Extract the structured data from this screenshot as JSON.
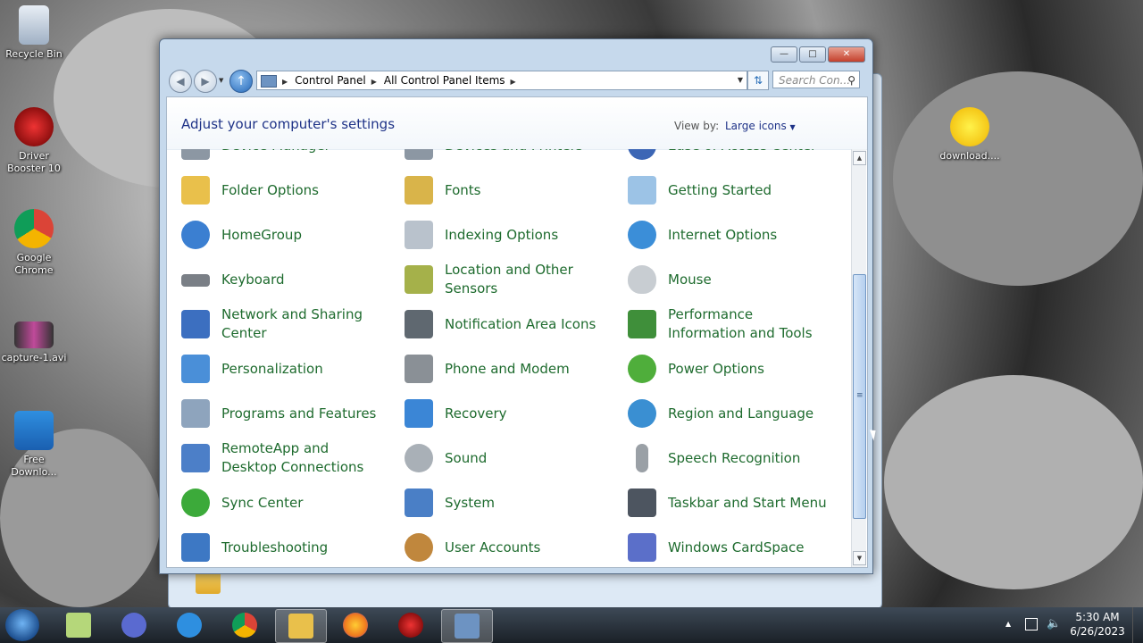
{
  "desktop": {
    "icons": [
      {
        "label": "Recycle Bin",
        "icon": "recycle-bin-icon"
      },
      {
        "label": "Driver Booster 10",
        "icon": "driver-booster-icon"
      },
      {
        "label": "Google Chrome",
        "icon": "chrome-icon"
      },
      {
        "label": "capture-1.avi",
        "icon": "video-file-icon"
      },
      {
        "label": "Free Downlo...",
        "icon": "free-download-icon"
      },
      {
        "label": "download....",
        "icon": "smiley-image-icon"
      }
    ]
  },
  "window": {
    "breadcrumb": [
      "Control Panel",
      "All Control Panel Items"
    ],
    "search_placeholder": "Search Con...",
    "header_title": "Adjust your computer's settings",
    "view_by_label": "View by:",
    "view_by_value": "Large icons",
    "partial_top_items": [
      "Device Manager",
      "Devices and Printers",
      "Ease of Access Center"
    ],
    "items": [
      {
        "label": "Folder Options",
        "color": "#e9c04b"
      },
      {
        "label": "Fonts",
        "color": "#d9b44a"
      },
      {
        "label": "Getting Started",
        "color": "#9cc3e6"
      },
      {
        "label": "HomeGroup",
        "color": "#3b7fd1"
      },
      {
        "label": "Indexing Options",
        "color": "#b9c2cc"
      },
      {
        "label": "Internet Options",
        "color": "#3b8ed8"
      },
      {
        "label": "Keyboard",
        "color": "#7a7f86"
      },
      {
        "label": "Location and Other Sensors",
        "color": "#a5b14a"
      },
      {
        "label": "Mouse",
        "color": "#c8cdd2"
      },
      {
        "label": "Network and Sharing Center",
        "color": "#3c6fc0"
      },
      {
        "label": "Notification Area Icons",
        "color": "#5f6870"
      },
      {
        "label": "Performance Information and Tools",
        "color": "#3f8f3a"
      },
      {
        "label": "Personalization",
        "color": "#4a8fd8"
      },
      {
        "label": "Phone and Modem",
        "color": "#8a9096"
      },
      {
        "label": "Power Options",
        "color": "#4fae3b"
      },
      {
        "label": "Programs and Features",
        "color": "#8ea4bd"
      },
      {
        "label": "Recovery",
        "color": "#3b86d6"
      },
      {
        "label": "Region and Language",
        "color": "#3a8fd2"
      },
      {
        "label": "RemoteApp and Desktop Connections",
        "color": "#4c7fc8"
      },
      {
        "label": "Sound",
        "color": "#a9b0b7"
      },
      {
        "label": "Speech Recognition",
        "color": "#9aa0a6"
      },
      {
        "label": "Sync Center",
        "color": "#3caa3a"
      },
      {
        "label": "System",
        "color": "#4a7fc6"
      },
      {
        "label": "Taskbar and Start Menu",
        "color": "#4d5560"
      },
      {
        "label": "Troubleshooting",
        "color": "#3d78c4"
      },
      {
        "label": "User Accounts",
        "color": "#c0873d"
      },
      {
        "label": "Windows CardSpace",
        "color": "#5b6fc9"
      }
    ]
  },
  "taskbar": {
    "time": "5:30 AM",
    "date": "6/26/2023",
    "pinned": [
      {
        "name": "sticky-notes-icon",
        "color": "#b5d77a"
      },
      {
        "name": "infinity-app-icon",
        "color": "#5a6ad0"
      },
      {
        "name": "internet-explorer-icon",
        "color": "#2e8fe0"
      },
      {
        "name": "chrome-icon",
        "color": "#e24a3b"
      },
      {
        "name": "file-explorer-icon",
        "color": "#e9c04b"
      },
      {
        "name": "firefox-icon",
        "color": "#ef7b1e"
      },
      {
        "name": "driver-booster-icon",
        "color": "#c21e1e"
      },
      {
        "name": "control-panel-icon",
        "color": "#6d93c2"
      }
    ]
  }
}
